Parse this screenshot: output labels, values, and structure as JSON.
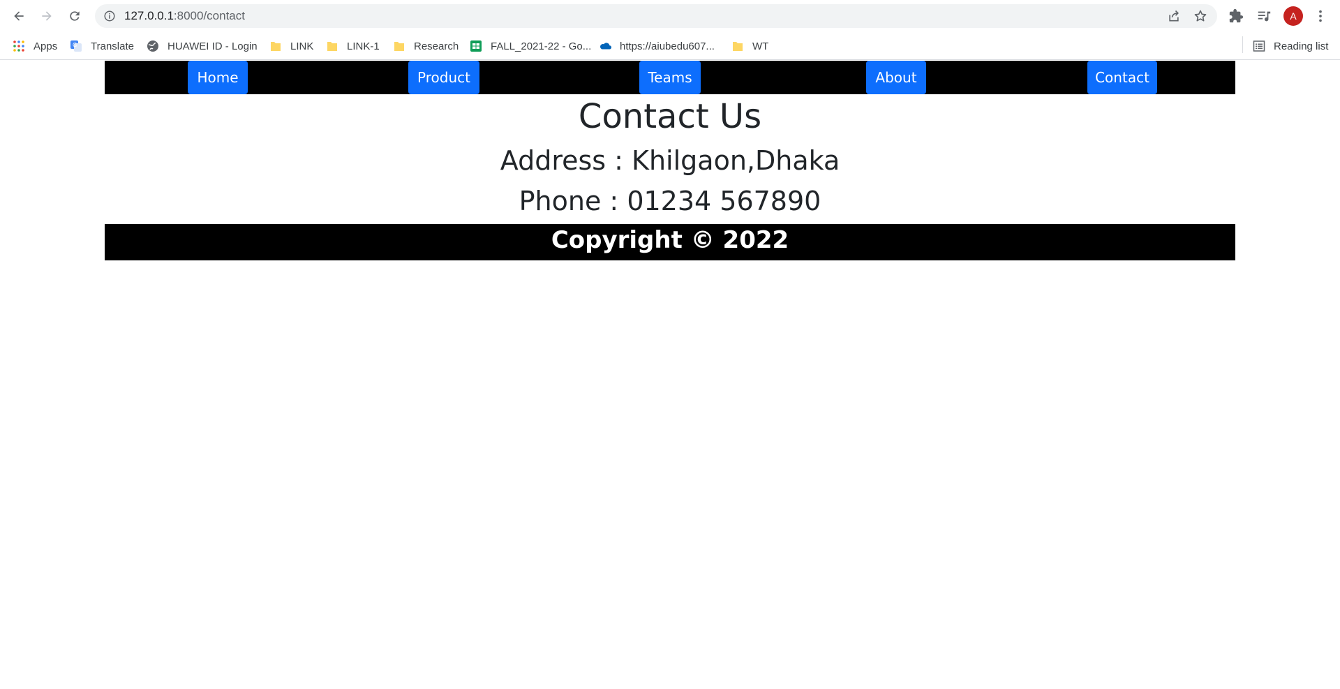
{
  "browser": {
    "url_host": "127.0.0.1",
    "url_path": ":8000/contact",
    "avatar_letter": "A",
    "bookmarks": [
      {
        "label": "Apps",
        "icon": "apps-grid-icon"
      },
      {
        "label": "Translate",
        "icon": "translate-icon"
      },
      {
        "label": "HUAWEI ID - Login",
        "icon": "globe-icon"
      },
      {
        "label": "LINK",
        "icon": "folder-icon"
      },
      {
        "label": "LINK-1",
        "icon": "folder-icon"
      },
      {
        "label": "Research",
        "icon": "folder-icon"
      },
      {
        "label": "FALL_2021-22 - Go...",
        "icon": "sheets-icon"
      },
      {
        "label": "https://aiubedu607...",
        "icon": "onedrive-icon"
      },
      {
        "label": "WT",
        "icon": "folder-icon"
      }
    ],
    "reading_list": "Reading list"
  },
  "nav": {
    "items": [
      "Home",
      "Product",
      "Teams",
      "About",
      "Contact"
    ]
  },
  "content": {
    "title": "Contact Us",
    "address": "Address : Khilgaon,Dhaka",
    "phone": "Phone : 01234 567890"
  },
  "footer": {
    "copyright": "Copyright © 2022"
  },
  "colors": {
    "nav_bg": "#000000",
    "button_bg": "#0d6efd",
    "text": "#212529",
    "avatar": "#c5221f"
  }
}
